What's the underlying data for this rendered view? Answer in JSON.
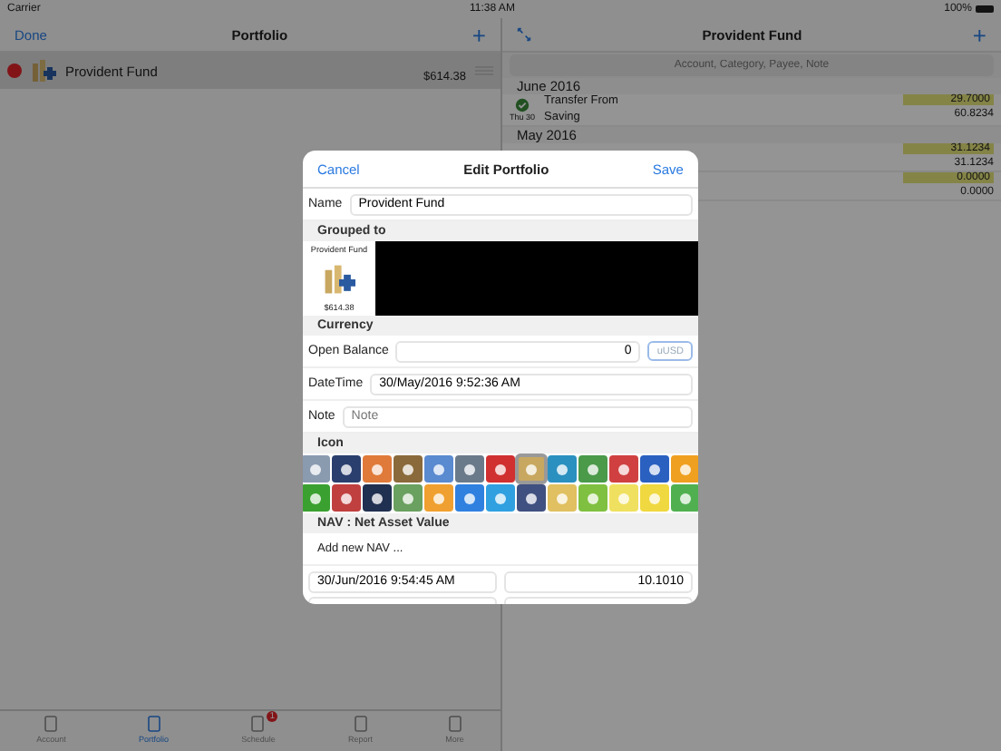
{
  "status_bar": {
    "carrier": "Carrier",
    "time": "11:38 AM",
    "battery": "100%"
  },
  "left_pane": {
    "done": "Done",
    "title": "Portfolio",
    "add": "+",
    "portfolios": [
      {
        "name": "Provident Fund",
        "amount": "$614.38",
        "selected": true
      }
    ]
  },
  "right_pane": {
    "title": "Provident Fund",
    "add": "+",
    "search": {
      "placeholder": "Account, Category, Payee, Note"
    },
    "groups": [
      {
        "month": "June 2016",
        "rows": [
          {
            "day": "Thu 30",
            "title": "Transfer From",
            "subtitle": "Saving",
            "amount": "29.7000",
            "balance": "60.8234"
          }
        ]
      },
      {
        "month": "May 2016",
        "rows": [
          {
            "amount": "31.1234",
            "balance": "31.1234"
          },
          {
            "amount": "0.0000",
            "balance": "0.0000"
          }
        ]
      }
    ]
  },
  "tab_bar": [
    {
      "label": "Account",
      "selected": false
    },
    {
      "label": "Portfolio",
      "selected": true
    },
    {
      "label": "Schedule",
      "selected": false,
      "badge": "1"
    },
    {
      "label": "Report",
      "selected": false
    },
    {
      "label": "More",
      "selected": false
    }
  ],
  "dialog": {
    "cancel": "Cancel",
    "title": "Edit Portfolio",
    "save": "Save",
    "name_label": "Name",
    "name_value": "Provident Fund",
    "grouped_label": "Grouped to",
    "group_card": {
      "name": "Provident Fund",
      "amount": "$614.38"
    },
    "currency_label": "Currency",
    "open_balance_label": "Open Balance",
    "open_balance_value": "0",
    "currency_button": "uUSD",
    "datetime_label": "DateTime",
    "datetime_value": "30/May/2016 9:52:36 AM",
    "note_label": "Note",
    "note_placeholder": "Note",
    "icon_label": "Icon",
    "icons": [
      {
        "color": "#8a9bb0",
        "selected": false
      },
      {
        "color": "#2a3f6e",
        "selected": false
      },
      {
        "color": "#e07a3a",
        "selected": false
      },
      {
        "color": "#8a6a3a",
        "selected": false
      },
      {
        "color": "#5a8ad0",
        "selected": false
      },
      {
        "color": "#6a7a8a",
        "selected": false
      },
      {
        "color": "#d03030",
        "selected": false
      },
      {
        "color": "#c8a860",
        "selected": true
      },
      {
        "color": "#2a90c0",
        "selected": false
      },
      {
        "color": "#4a9a4a",
        "selected": false
      },
      {
        "color": "#d04040",
        "selected": false
      },
      {
        "color": "#2a60c0",
        "selected": false
      },
      {
        "color": "#f0a020",
        "selected": false
      },
      {
        "color": "#3aa030",
        "selected": false
      },
      {
        "color": "#c04040",
        "selected": false
      },
      {
        "color": "#203050",
        "selected": false
      },
      {
        "color": "#6aa060",
        "selected": false
      },
      {
        "color": "#f0a030",
        "selected": false
      },
      {
        "color": "#3080e0",
        "selected": false
      },
      {
        "color": "#30a0e0",
        "selected": false
      },
      {
        "color": "#405080",
        "selected": false
      },
      {
        "color": "#e0c060",
        "selected": false
      },
      {
        "color": "#80c040",
        "selected": false
      },
      {
        "color": "#f0e060",
        "selected": false
      },
      {
        "color": "#f0d840",
        "selected": false
      },
      {
        "color": "#50b050",
        "selected": false
      }
    ],
    "nav_label": "NAV : Net Asset Value",
    "add_nav": "Add new NAV ...",
    "nav_rows": [
      {
        "date": "30/Jun/2016 9:54:45 AM",
        "value": "10.1010"
      }
    ]
  }
}
